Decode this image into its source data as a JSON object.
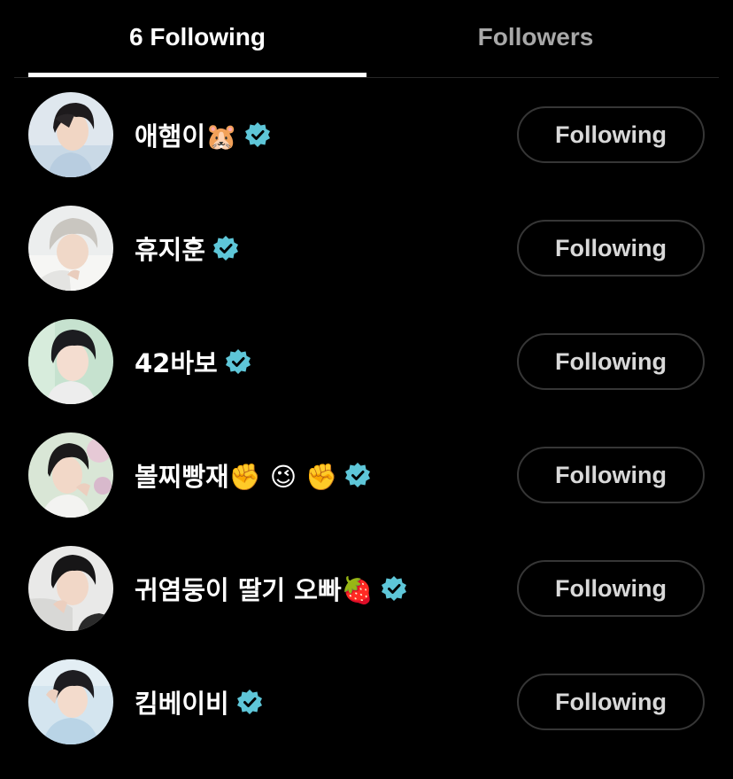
{
  "tabs": {
    "following_label": "6 Following",
    "followers_label": "Followers"
  },
  "accent_colors": {
    "verified_badge": "#5ec6d8",
    "active_tab_indicator": "#ffffff",
    "inactive_tab_text": "#a8a8a8"
  },
  "users": [
    {
      "name": "애햄이🐹",
      "verified": true,
      "button_label": "Following",
      "avatar_icon": "profile-photo"
    },
    {
      "name": "휴지훈",
      "verified": true,
      "button_label": "Following",
      "avatar_icon": "profile-photo"
    },
    {
      "name": "42바보",
      "verified": true,
      "button_label": "Following",
      "avatar_icon": "profile-photo"
    },
    {
      "name": "볼찌빵재✊ 😉 ✊",
      "verified": true,
      "button_label": "Following",
      "avatar_icon": "profile-photo"
    },
    {
      "name": "귀염둥이 딸기 오빠🍓",
      "verified": true,
      "button_label": "Following",
      "avatar_icon": "profile-photo"
    },
    {
      "name": "킴베이비",
      "verified": true,
      "button_label": "Following",
      "avatar_icon": "profile-photo"
    }
  ]
}
